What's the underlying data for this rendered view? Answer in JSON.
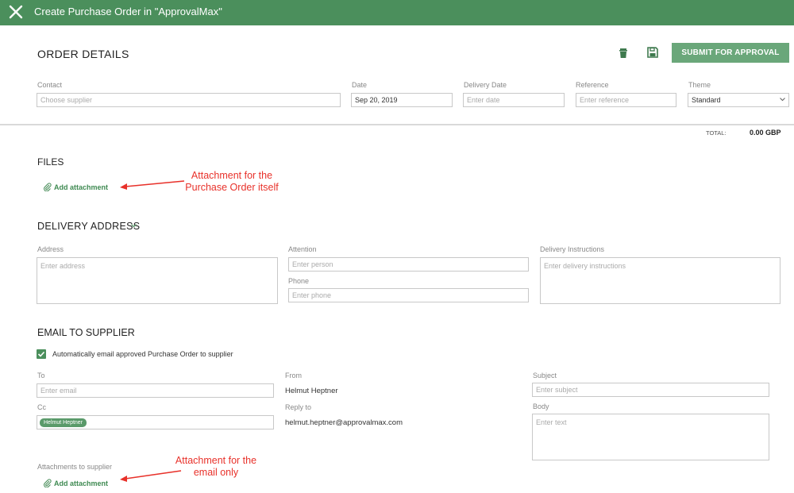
{
  "header": {
    "title": "Create Purchase Order in \"ApprovalMax\""
  },
  "order_details": {
    "heading": "ORDER DETAILS",
    "submit_label": "SUBMIT FOR APPROVAL",
    "contact": {
      "label": "Contact",
      "placeholder": "Choose supplier"
    },
    "date": {
      "label": "Date",
      "value": "Sep 20, 2019"
    },
    "delivery_date": {
      "label": "Delivery Date",
      "placeholder": "Enter date"
    },
    "reference": {
      "label": "Reference",
      "placeholder": "Enter reference"
    },
    "theme": {
      "label": "Theme",
      "value": "Standard"
    },
    "total_label": "TOTAL:",
    "total_value": "0.00 GBP"
  },
  "files": {
    "heading": "FILES",
    "add_attachment": "Add attachment",
    "annotation": "Attachment for the Purchase Order itself"
  },
  "delivery": {
    "heading": "DELIVERY ADDRESS",
    "address": {
      "label": "Address",
      "placeholder": "Enter address"
    },
    "attention": {
      "label": "Attention",
      "placeholder": "Enter person"
    },
    "phone": {
      "label": "Phone",
      "placeholder": "Enter phone"
    },
    "instructions": {
      "label": "Delivery Instructions",
      "placeholder": "Enter delivery instructions"
    }
  },
  "email": {
    "heading": "EMAIL TO SUPPLIER",
    "auto_email_label": "Automatically email approved Purchase Order to supplier",
    "auto_email_checked": true,
    "to": {
      "label": "To",
      "placeholder": "Enter email"
    },
    "cc": {
      "label": "Cc",
      "chip": "Helmut Heptner"
    },
    "from": {
      "label": "From",
      "value": "Helmut Heptner"
    },
    "reply_to": {
      "label": "Reply to",
      "value": "helmut.heptner@approvalmax.com"
    },
    "subject": {
      "label": "Subject",
      "placeholder": "Enter subject"
    },
    "body": {
      "label": "Body",
      "placeholder": "Enter text"
    },
    "attachments_label": "Attachments to supplier",
    "add_attachment": "Add attachment",
    "annotation": "Attachment for the email only"
  },
  "colors": {
    "brand_green": "#4b8f5c",
    "button_green": "#6aa77a",
    "annotation_red": "#e8312a"
  }
}
